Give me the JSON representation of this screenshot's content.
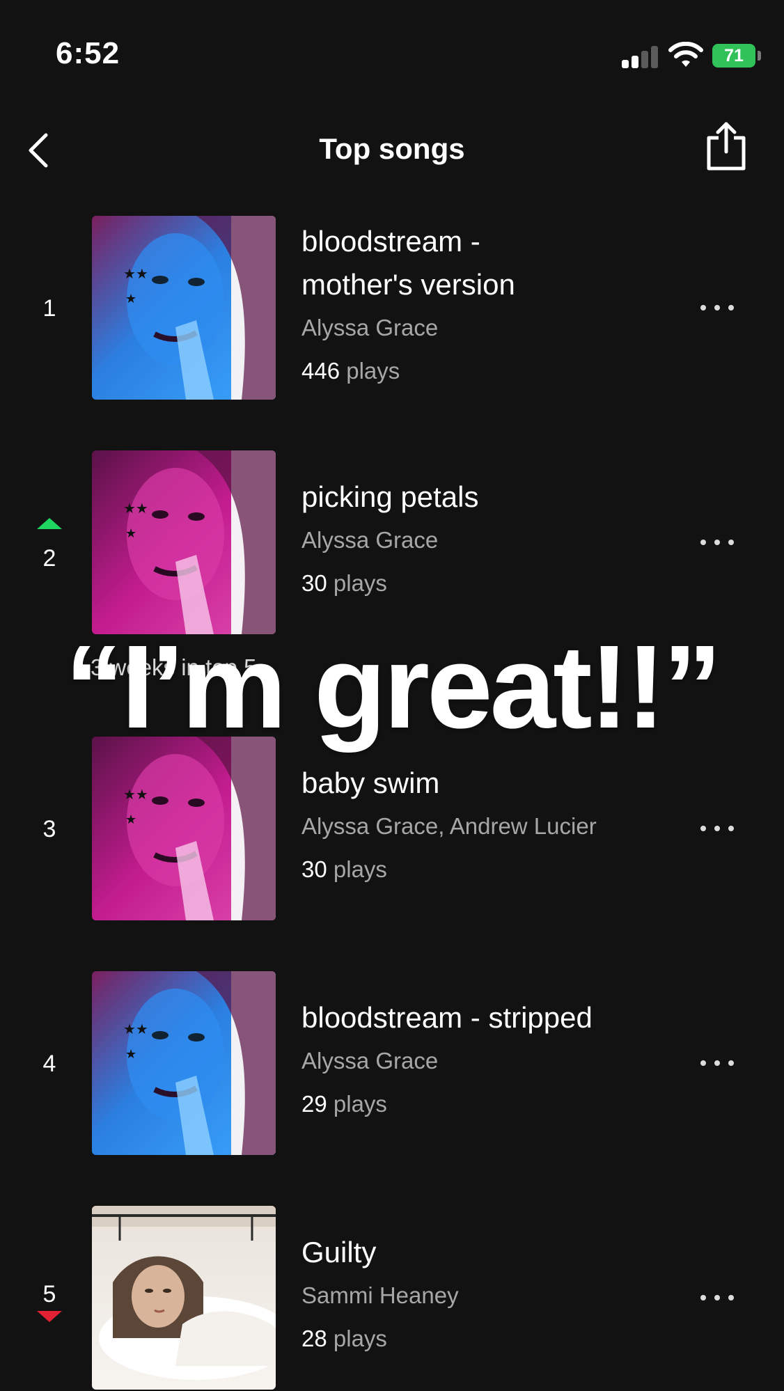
{
  "status_bar": {
    "time": "6:52",
    "battery": "71"
  },
  "header": {
    "title": "Top songs",
    "back_icon": "chevron-left-icon",
    "share_icon": "share-icon"
  },
  "songs": [
    {
      "rank": "1",
      "title_line1": "bloodstream -",
      "title_line2": "mother's version",
      "artist": "Alyssa Grace",
      "plays_count": "446",
      "plays_label": " plays",
      "trend": "none",
      "cover": "blue-tint-portrait"
    },
    {
      "rank": "2",
      "title_line1": "picking petals",
      "artist": "Alyssa Grace",
      "plays_count": "30",
      "plays_label": " plays",
      "trend": "up",
      "cover": "magenta-tint-portrait"
    },
    {
      "rank": "3",
      "title_line1": "baby swim",
      "artist": "Alyssa Grace, Andrew Lucier",
      "plays_count": "30",
      "plays_label": " plays",
      "trend": "none",
      "cover": "magenta-tint-portrait"
    },
    {
      "rank": "4",
      "title_line1": "bloodstream - stripped",
      "artist": "Alyssa Grace",
      "plays_count": "29",
      "plays_label": " plays",
      "trend": "none",
      "cover": "blue-tint-portrait"
    },
    {
      "rank": "5",
      "title_line1": "Guilty",
      "artist": "Sammi Heaney",
      "plays_count": "28",
      "plays_label": " plays",
      "trend": "down",
      "cover": "bedroom-photo"
    }
  ],
  "weeks_note": "3 weeks in top 5",
  "overlay_caption": "“I’m great!!”",
  "colors": {
    "background": "#121212",
    "trend_up": "#1ed760",
    "trend_down": "#e22134",
    "battery": "#30c158",
    "secondary_text": "#a7a7a7"
  }
}
